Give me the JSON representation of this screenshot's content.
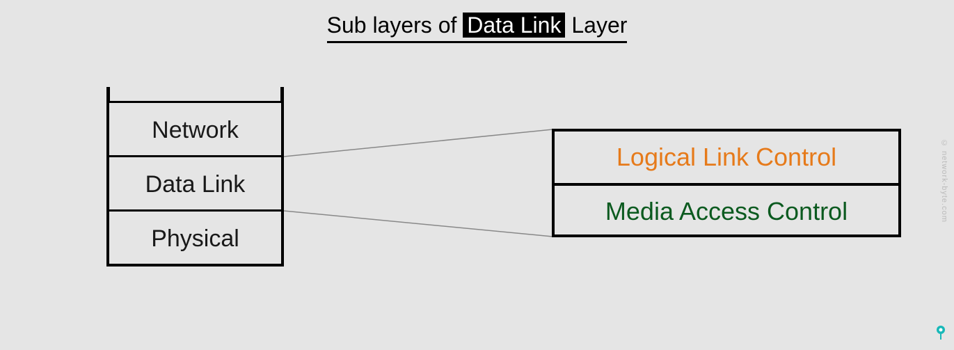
{
  "title": {
    "prefix": "Sub layers of ",
    "highlight": "Data Link",
    "suffix": " Layer"
  },
  "stack": {
    "layers": [
      "Network",
      "Data Link",
      "Physical"
    ]
  },
  "sublayers": {
    "llc": "Logical Link Control",
    "mac": "Media Access Control"
  },
  "watermark": "© network-byte.com",
  "colors": {
    "llc": "#e67a1a",
    "mac": "#0b5a1f",
    "accent": "#17b8b8"
  }
}
